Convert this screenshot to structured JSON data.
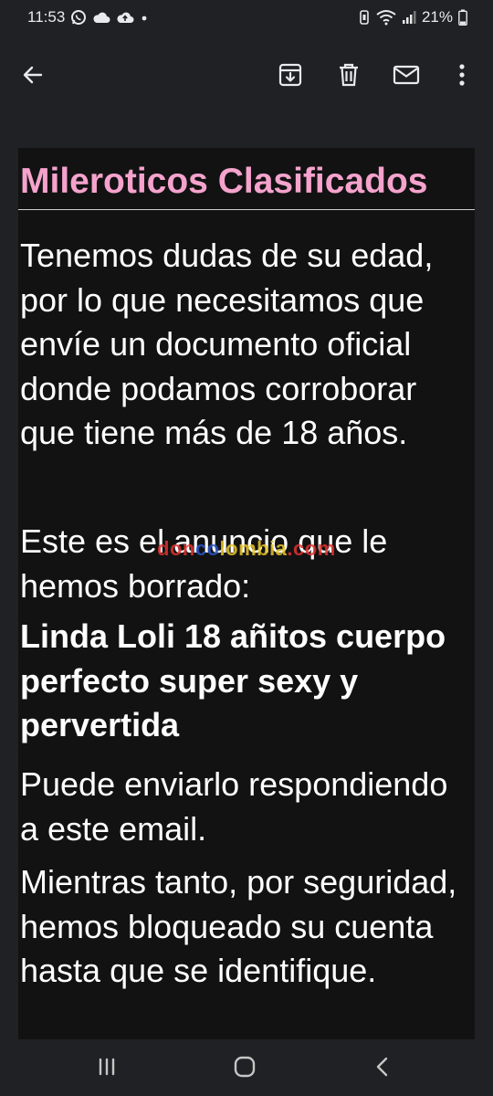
{
  "status_bar": {
    "time": "11:53",
    "battery_percent": "21%",
    "left_icons": [
      "whatsapp-icon",
      "cloud-icon",
      "cloud-upload-icon",
      "dot-icon"
    ],
    "right_icons": [
      "vibrate-icon",
      "wifi-icon",
      "signal-icon",
      "battery-icon"
    ]
  },
  "app_bar": {
    "icons": [
      "back-arrow-icon",
      "archive-icon",
      "delete-icon",
      "mail-icon",
      "more-vert-icon"
    ]
  },
  "email": {
    "title": "Mileroticos Clasificados",
    "paragraphs": [
      "Tenemos dudas de su edad, por lo que necesitamos que envíe un documento oficial donde podamos corroborar que tiene más de 18 años.",
      "Este es el anuncio que le hemos borrado:",
      "Linda Loli 18 añitos cuerpo perfecto super sexy y pervertida",
      "Puede enviarlo respondiendo a este email.",
      "Mientras tanto, por seguridad, hemos bloqueado su cuenta hasta que se identifique."
    ]
  },
  "watermark": {
    "part1": "don",
    "part2": "co",
    "part3": "lombia",
    "part4": ".com"
  },
  "colors": {
    "background": "#202124",
    "card": "#121212",
    "title": "#f5a3cd",
    "text": "#ffffff"
  },
  "nav_bar": {
    "icons": [
      "recents-icon",
      "home-icon",
      "back-icon"
    ]
  }
}
